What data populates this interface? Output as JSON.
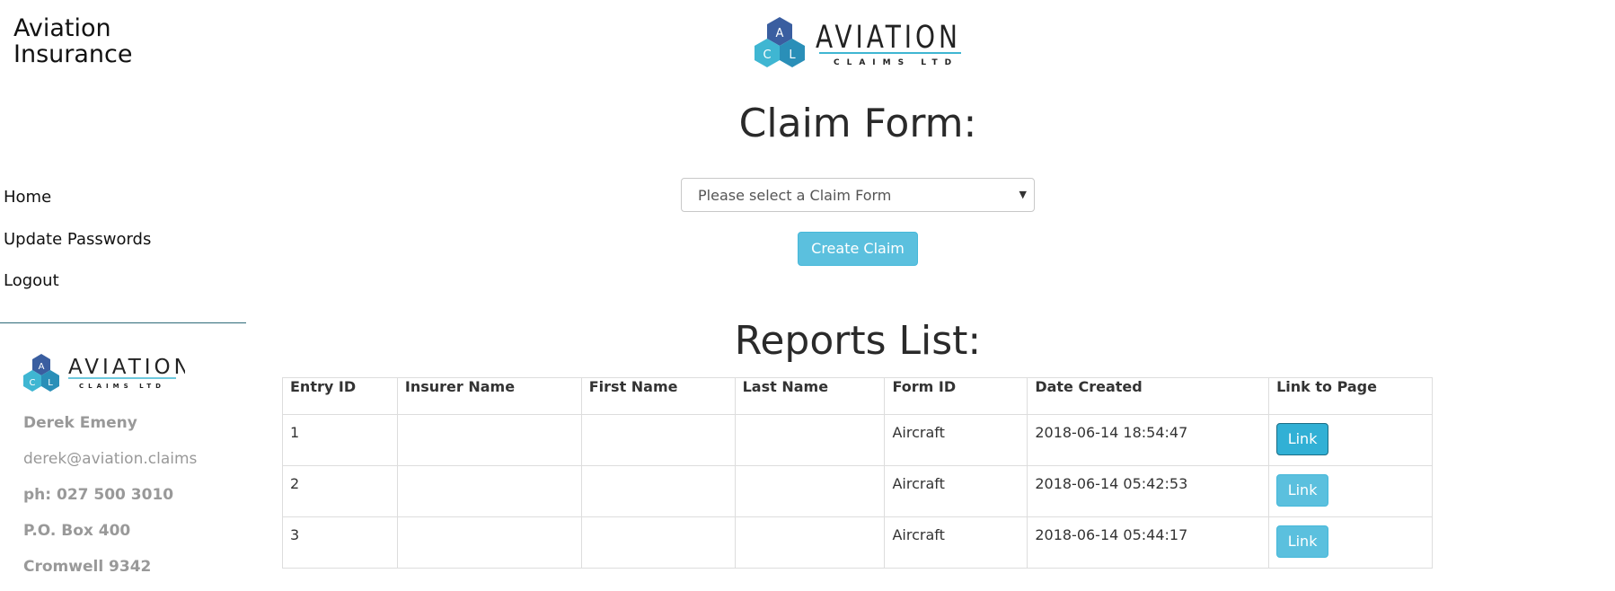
{
  "sidebar": {
    "brand_title": "Aviation Insurance",
    "nav": [
      {
        "label": "Home"
      },
      {
        "label": "Update Passwords"
      },
      {
        "label": "Logout"
      }
    ],
    "contact": {
      "name": "Derek Emeny",
      "email": "derek@aviation.claims",
      "phone": "ph: 027 500 3010",
      "po_box": "P.O. Box 400",
      "city": "Cromwell 9342"
    }
  },
  "logo": {
    "word": "AVIATION",
    "sub": "CLAIMS LTD",
    "letters": [
      "A",
      "C",
      "L"
    ],
    "colors": {
      "dark": "#3a5ea0",
      "light": "#3fb6d2",
      "mid": "#2a8fb8"
    }
  },
  "claim_form": {
    "title": "Claim Form:",
    "select_placeholder": "Please select a Claim Form",
    "create_button": "Create Claim"
  },
  "reports": {
    "title": "Reports List:",
    "columns": [
      "Entry ID",
      "Insurer Name",
      "First Name",
      "Last Name",
      "Form ID",
      "Date Created",
      "Link to Page"
    ],
    "rows": [
      {
        "entry_id": "1",
        "insurer": "",
        "first": "",
        "last": "",
        "form_id": "Aircraft",
        "date": "2018-06-14 18:54:47",
        "link": "Link"
      },
      {
        "entry_id": "2",
        "insurer": "",
        "first": "",
        "last": "",
        "form_id": "Aircraft",
        "date": "2018-06-14 05:42:53",
        "link": "Link"
      },
      {
        "entry_id": "3",
        "insurer": "",
        "first": "",
        "last": "",
        "form_id": "Aircraft",
        "date": "2018-06-14 05:44:17",
        "link": "Link"
      }
    ]
  },
  "colors": {
    "accent": "#5bc0de",
    "divider": "#2d6a78"
  }
}
